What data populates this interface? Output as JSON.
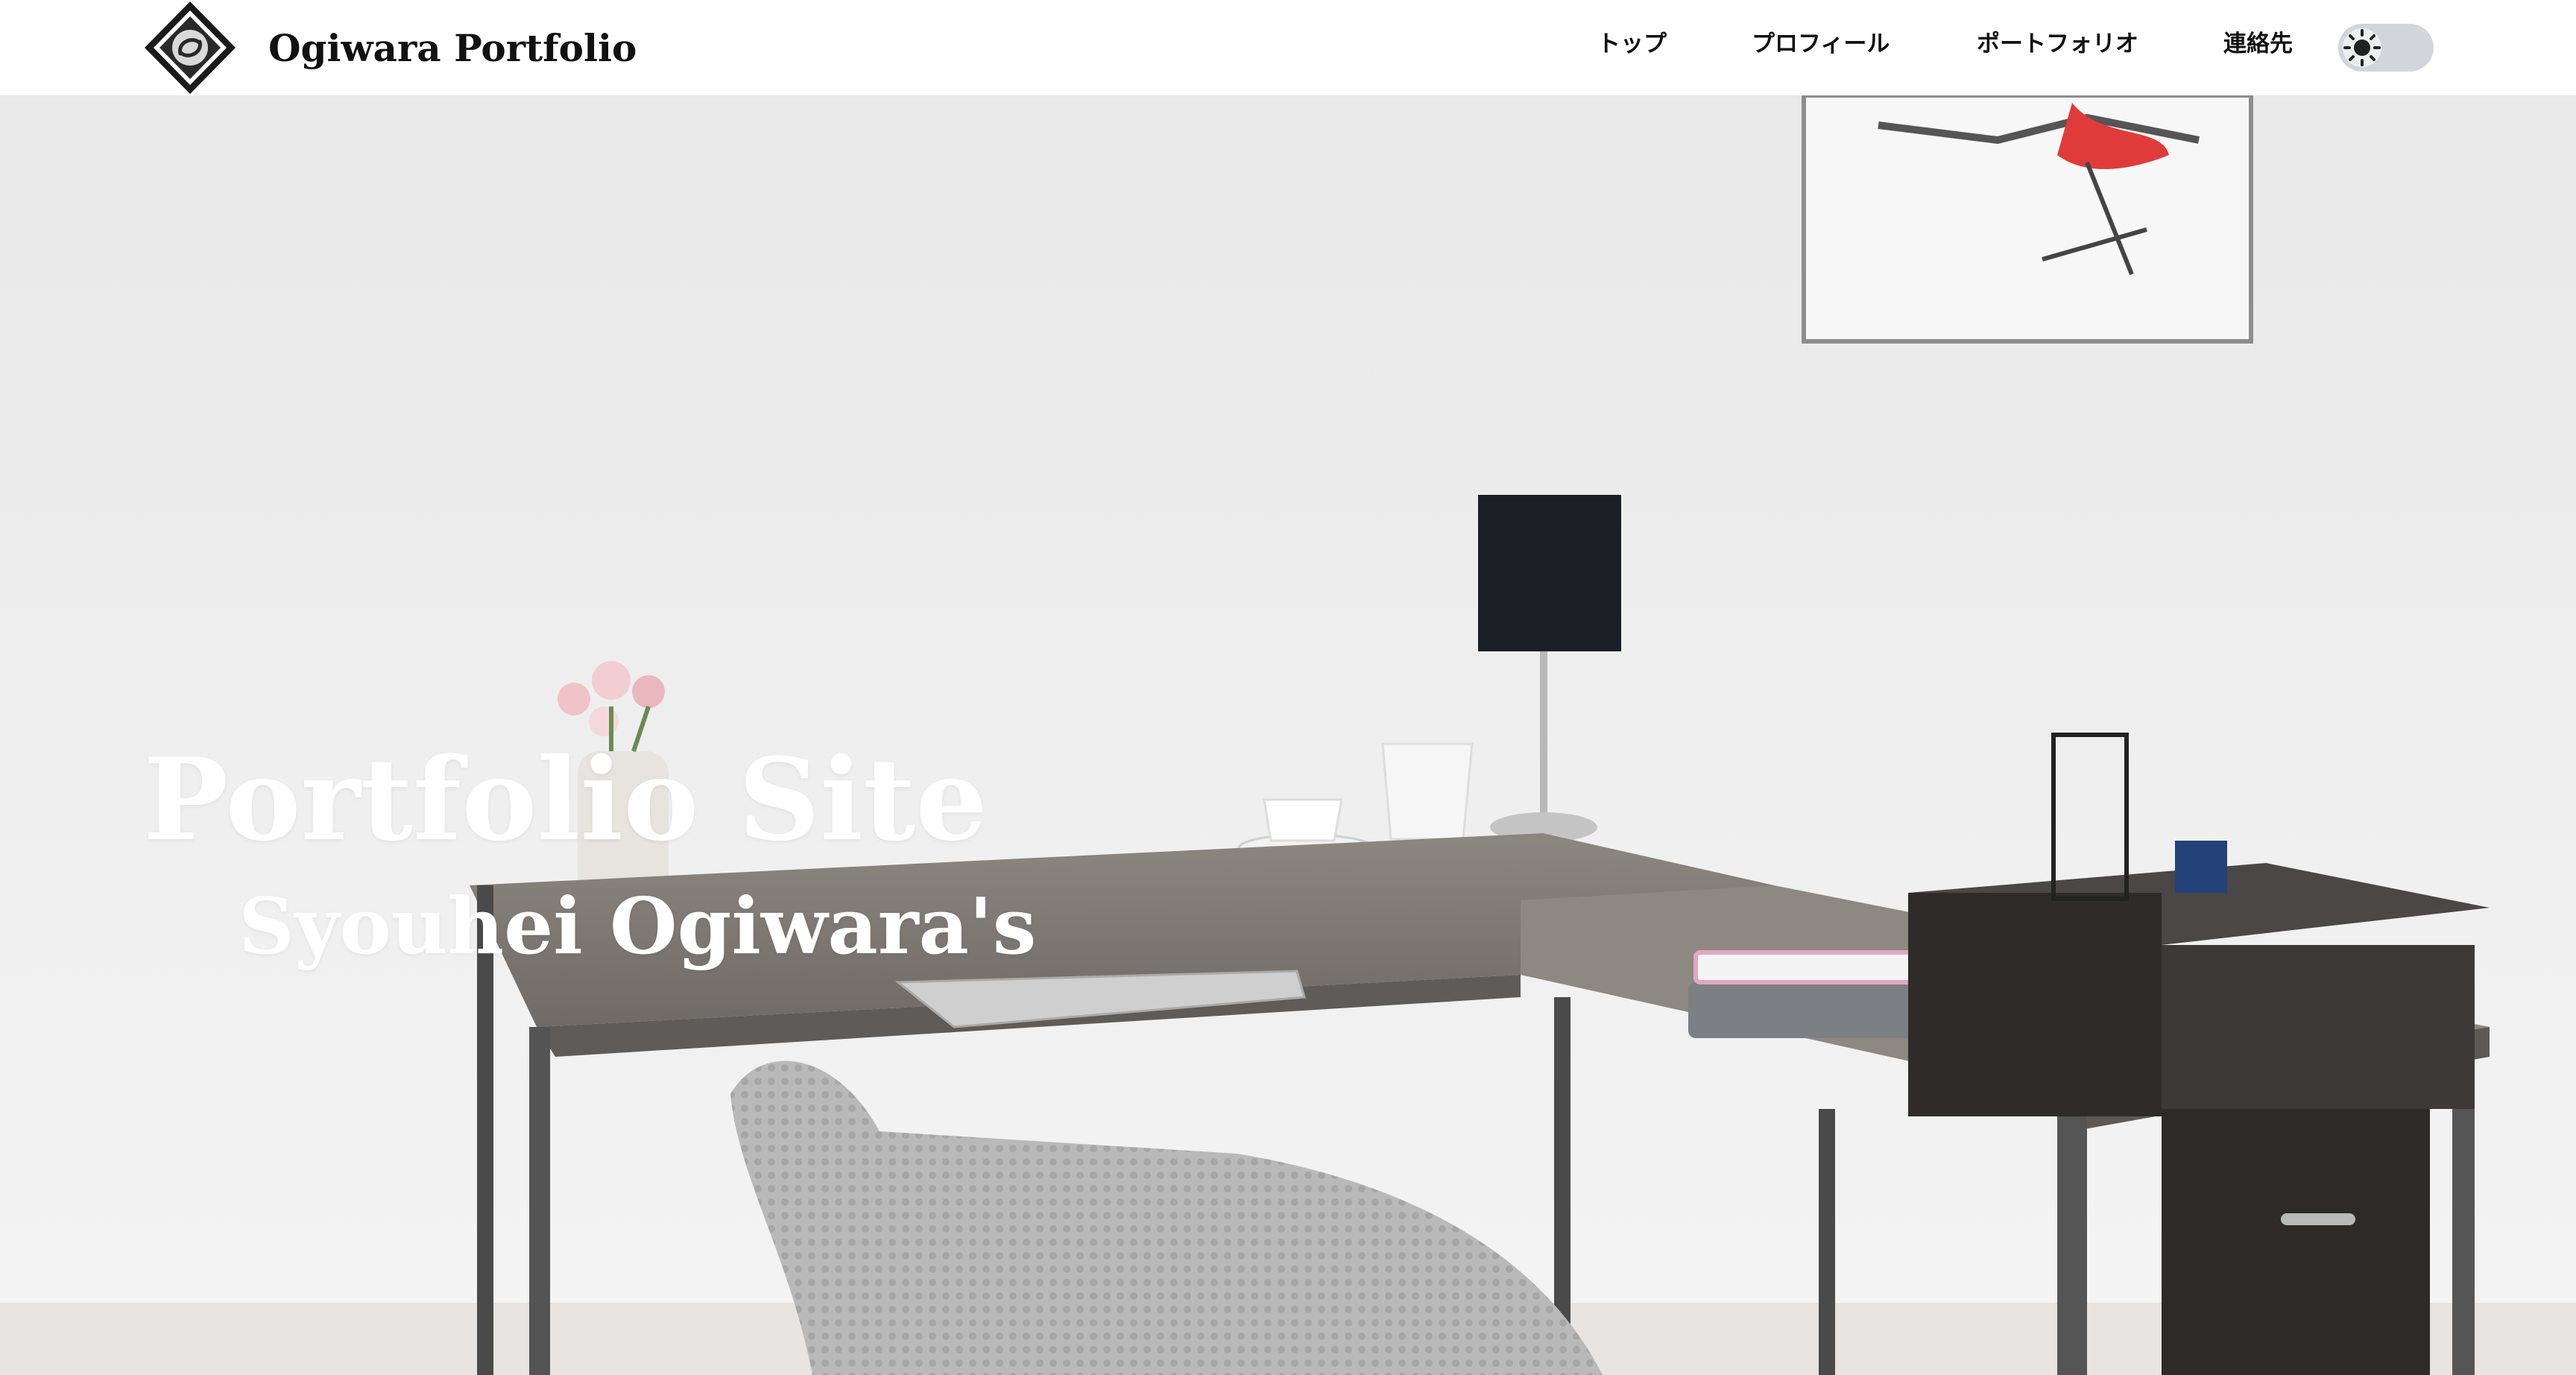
{
  "header": {
    "site_title": "Ogiwara Portfolio",
    "logo_icon": "diamond-logo-icon",
    "nav": [
      {
        "label": "トップ"
      },
      {
        "label": "プロフィール"
      },
      {
        "label": "ポートフォリオ"
      },
      {
        "label": "連絡先"
      }
    ],
    "theme_toggle": {
      "icon": "sun-icon",
      "state": "light"
    }
  },
  "hero": {
    "title": "Portfolio Site",
    "subtitle": "Syouhei Ogiwara's",
    "image": "office-desk-photo"
  },
  "colors": {
    "header_bg": "#ffffff",
    "text": "#111111",
    "hero_text": "#ffffff",
    "toggle_bg": "#d3d5da"
  }
}
